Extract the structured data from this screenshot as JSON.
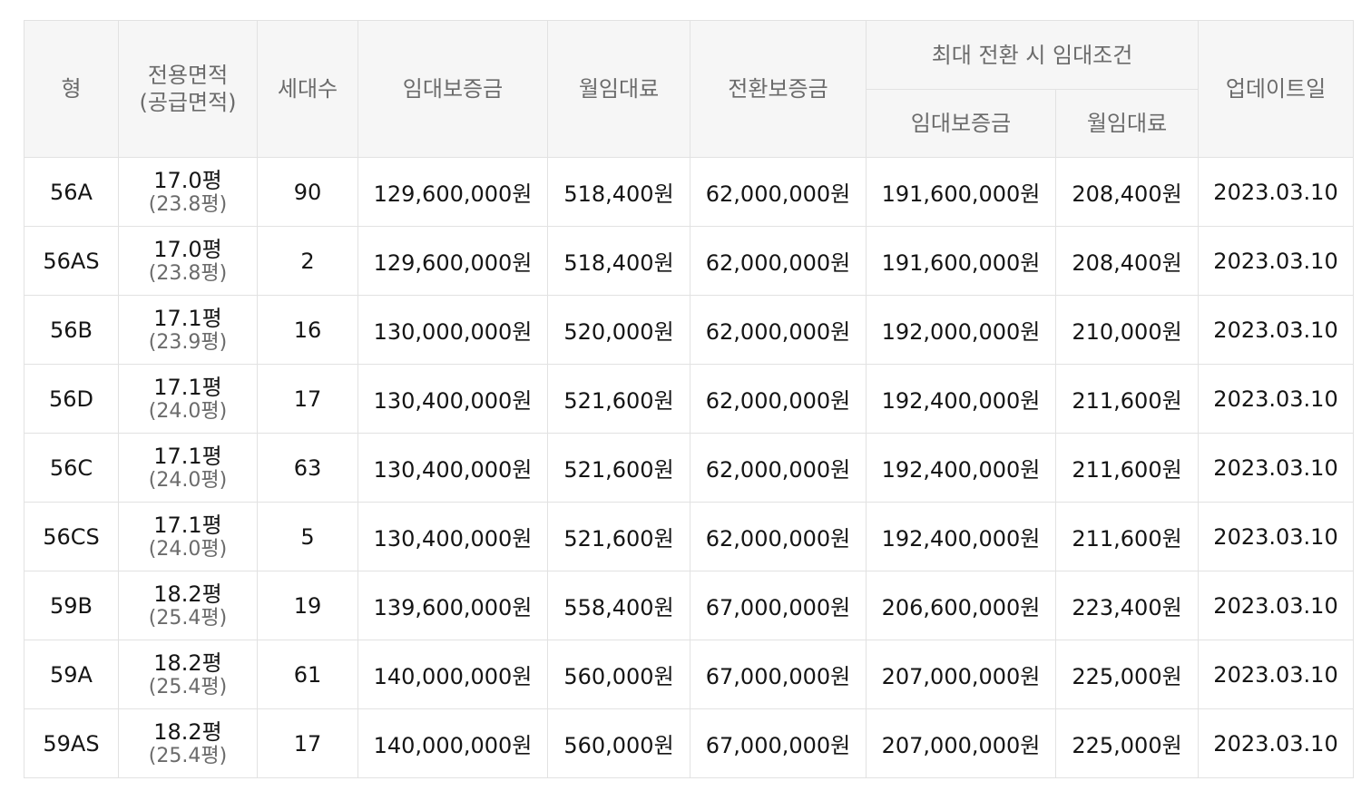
{
  "table": {
    "headers": {
      "type": "형",
      "area_line1": "전용면적",
      "area_line2": "(공급면적)",
      "households": "세대수",
      "deposit": "임대보증금",
      "monthly_rent": "월임대료",
      "conversion_deposit": "전환보증금",
      "max_group": "최대 전환 시 임대조건",
      "max_deposit": "임대보증금",
      "max_monthly_rent": "월임대료",
      "updated": "업데이트일"
    },
    "rows": [
      {
        "type": "56A",
        "area": "17.0평",
        "supply_area": "(23.8평)",
        "households": "90",
        "deposit": "129,600,000원",
        "monthly_rent": "518,400원",
        "conversion_deposit": "62,000,000원",
        "max_deposit": "191,600,000원",
        "max_monthly_rent": "208,400원",
        "updated": "2023.03.10"
      },
      {
        "type": "56AS",
        "area": "17.0평",
        "supply_area": "(23.8평)",
        "households": "2",
        "deposit": "129,600,000원",
        "monthly_rent": "518,400원",
        "conversion_deposit": "62,000,000원",
        "max_deposit": "191,600,000원",
        "max_monthly_rent": "208,400원",
        "updated": "2023.03.10"
      },
      {
        "type": "56B",
        "area": "17.1평",
        "supply_area": "(23.9평)",
        "households": "16",
        "deposit": "130,000,000원",
        "monthly_rent": "520,000원",
        "conversion_deposit": "62,000,000원",
        "max_deposit": "192,000,000원",
        "max_monthly_rent": "210,000원",
        "updated": "2023.03.10"
      },
      {
        "type": "56D",
        "area": "17.1평",
        "supply_area": "(24.0평)",
        "households": "17",
        "deposit": "130,400,000원",
        "monthly_rent": "521,600원",
        "conversion_deposit": "62,000,000원",
        "max_deposit": "192,400,000원",
        "max_monthly_rent": "211,600원",
        "updated": "2023.03.10"
      },
      {
        "type": "56C",
        "area": "17.1평",
        "supply_area": "(24.0평)",
        "households": "63",
        "deposit": "130,400,000원",
        "monthly_rent": "521,600원",
        "conversion_deposit": "62,000,000원",
        "max_deposit": "192,400,000원",
        "max_monthly_rent": "211,600원",
        "updated": "2023.03.10"
      },
      {
        "type": "56CS",
        "area": "17.1평",
        "supply_area": "(24.0평)",
        "households": "5",
        "deposit": "130,400,000원",
        "monthly_rent": "521,600원",
        "conversion_deposit": "62,000,000원",
        "max_deposit": "192,400,000원",
        "max_monthly_rent": "211,600원",
        "updated": "2023.03.10"
      },
      {
        "type": "59B",
        "area": "18.2평",
        "supply_area": "(25.4평)",
        "households": "19",
        "deposit": "139,600,000원",
        "monthly_rent": "558,400원",
        "conversion_deposit": "67,000,000원",
        "max_deposit": "206,600,000원",
        "max_monthly_rent": "223,400원",
        "updated": "2023.03.10"
      },
      {
        "type": "59A",
        "area": "18.2평",
        "supply_area": "(25.4평)",
        "households": "61",
        "deposit": "140,000,000원",
        "monthly_rent": "560,000원",
        "conversion_deposit": "67,000,000원",
        "max_deposit": "207,000,000원",
        "max_monthly_rent": "225,000원",
        "updated": "2023.03.10"
      },
      {
        "type": "59AS",
        "area": "18.2평",
        "supply_area": "(25.4평)",
        "households": "17",
        "deposit": "140,000,000원",
        "monthly_rent": "560,000원",
        "conversion_deposit": "67,000,000원",
        "max_deposit": "207,000,000원",
        "max_monthly_rent": "225,000원",
        "updated": "2023.03.10"
      }
    ]
  }
}
